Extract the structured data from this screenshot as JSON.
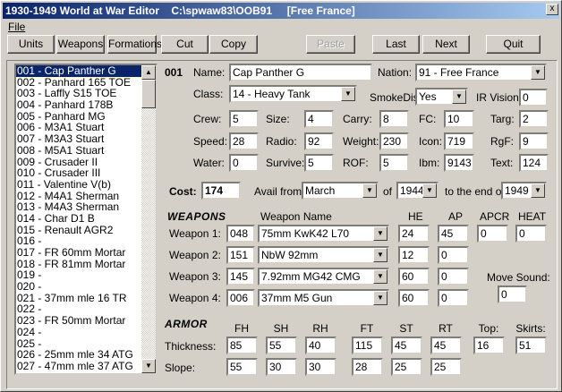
{
  "window": {
    "title": "1930-1949 World at War Editor    C:\\spwaw83\\OOB91     [Free France]",
    "close": "x"
  },
  "menu": {
    "file": "File"
  },
  "toolbar": {
    "units": "Units",
    "weapons": "Weapons",
    "formations": "Formations",
    "cut": "Cut",
    "copy": "Copy",
    "paste": "Paste",
    "last": "Last",
    "next": "Next",
    "quit": "Quit"
  },
  "unit_list": [
    "001 - Cap Panther G",
    "002 - Panhard 165 TOE",
    "003 - Laffly S15 TOE",
    "004 - Panhard 178B",
    "005 - Panhard MG",
    "006 - M3A1 Stuart",
    "007 - M3A3 Stuart",
    "008 - M5A1 Stuart",
    "009 - Crusader II",
    "010 - Crusader III",
    "011 - Valentine V(b)",
    "012 - M4A1 Sherman",
    "013 - M4A3 Sherman",
    "014 - Char D1 B",
    "015 - Renault AGR2",
    "016 -",
    "017 - FR 60mm Mortar",
    "018 - FR 81mm Mortar",
    "019 -",
    "020 -",
    "021 - 37mm mle 16 TR",
    "022 -",
    "023 - FR 50mm Mortar",
    "024 -",
    "025 -",
    "026 - 25mm mle 34 ATG",
    "027 - 47mm mle 37 ATG"
  ],
  "unit": {
    "number": "001",
    "name_label": "Name:",
    "name": "Cap Panther G",
    "nation_label": "Nation:",
    "nation": "91 - Free France",
    "class_label": "Class:",
    "class": "14 - Heavy Tank",
    "smoke_label": "SmokeDis:",
    "smoke": "Yes",
    "ir_label": "IR Vision:",
    "ir": "0",
    "stats": [
      {
        "label": "Crew:",
        "value": "5"
      },
      {
        "label": "Size:",
        "value": "4"
      },
      {
        "label": "Carry:",
        "value": "8"
      },
      {
        "label": "FC:",
        "value": "10"
      },
      {
        "label": "Targ:",
        "value": "2"
      },
      {
        "label": "Speed:",
        "value": "28"
      },
      {
        "label": "Radio:",
        "value": "92"
      },
      {
        "label": "Weight:",
        "value": "230"
      },
      {
        "label": "Icon:",
        "value": "719"
      },
      {
        "label": "RgF:",
        "value": "9"
      },
      {
        "label": "Water:",
        "value": "0"
      },
      {
        "label": "Survive:",
        "value": "5"
      },
      {
        "label": "ROF:",
        "value": "5"
      },
      {
        "label": "Ibm:",
        "value": "9143"
      },
      {
        "label": "Text:",
        "value": "124"
      }
    ],
    "cost_label": "Cost:",
    "cost": "174",
    "avail_label": "Avail from",
    "avail_month": "March",
    "of_label": "of",
    "avail_year": "1944",
    "end_label": "to the end of",
    "end_year": "1949"
  },
  "weapons": {
    "header": "WEAPONS",
    "name_header": "Weapon Name",
    "he_header": "HE",
    "ap_header": "AP",
    "apcr_header": "APCR",
    "heat_header": "HEAT",
    "rows": [
      {
        "label": "Weapon 1:",
        "id": "048",
        "name": "75mm KwK42 L70",
        "he": "24",
        "ap": "45"
      },
      {
        "label": "Weapon 2:",
        "id": "151",
        "name": "NbW 92mm",
        "he": "12",
        "ap": "0"
      },
      {
        "label": "Weapon 3:",
        "id": "145",
        "name": "7.92mm MG42 CMG",
        "he": "60",
        "ap": "0"
      },
      {
        "label": "Weapon 4:",
        "id": "006",
        "name": "37mm M5 Gun",
        "he": "60",
        "ap": "0"
      }
    ],
    "apcr": "0",
    "heat": "0",
    "move_sound_label": "Move Sound:",
    "move_sound": "0"
  },
  "armor": {
    "header": "ARMOR",
    "thickness_label": "Thickness:",
    "slope_label": "Slope:",
    "columns": [
      "FH",
      "SH",
      "RH",
      "FT",
      "ST",
      "RT",
      "Top:",
      "Skirts:"
    ],
    "thickness": [
      "85",
      "55",
      "40",
      "115",
      "45",
      "45",
      "16",
      "51"
    ],
    "slope": [
      "55",
      "30",
      "30",
      "28",
      "25",
      "25"
    ]
  }
}
